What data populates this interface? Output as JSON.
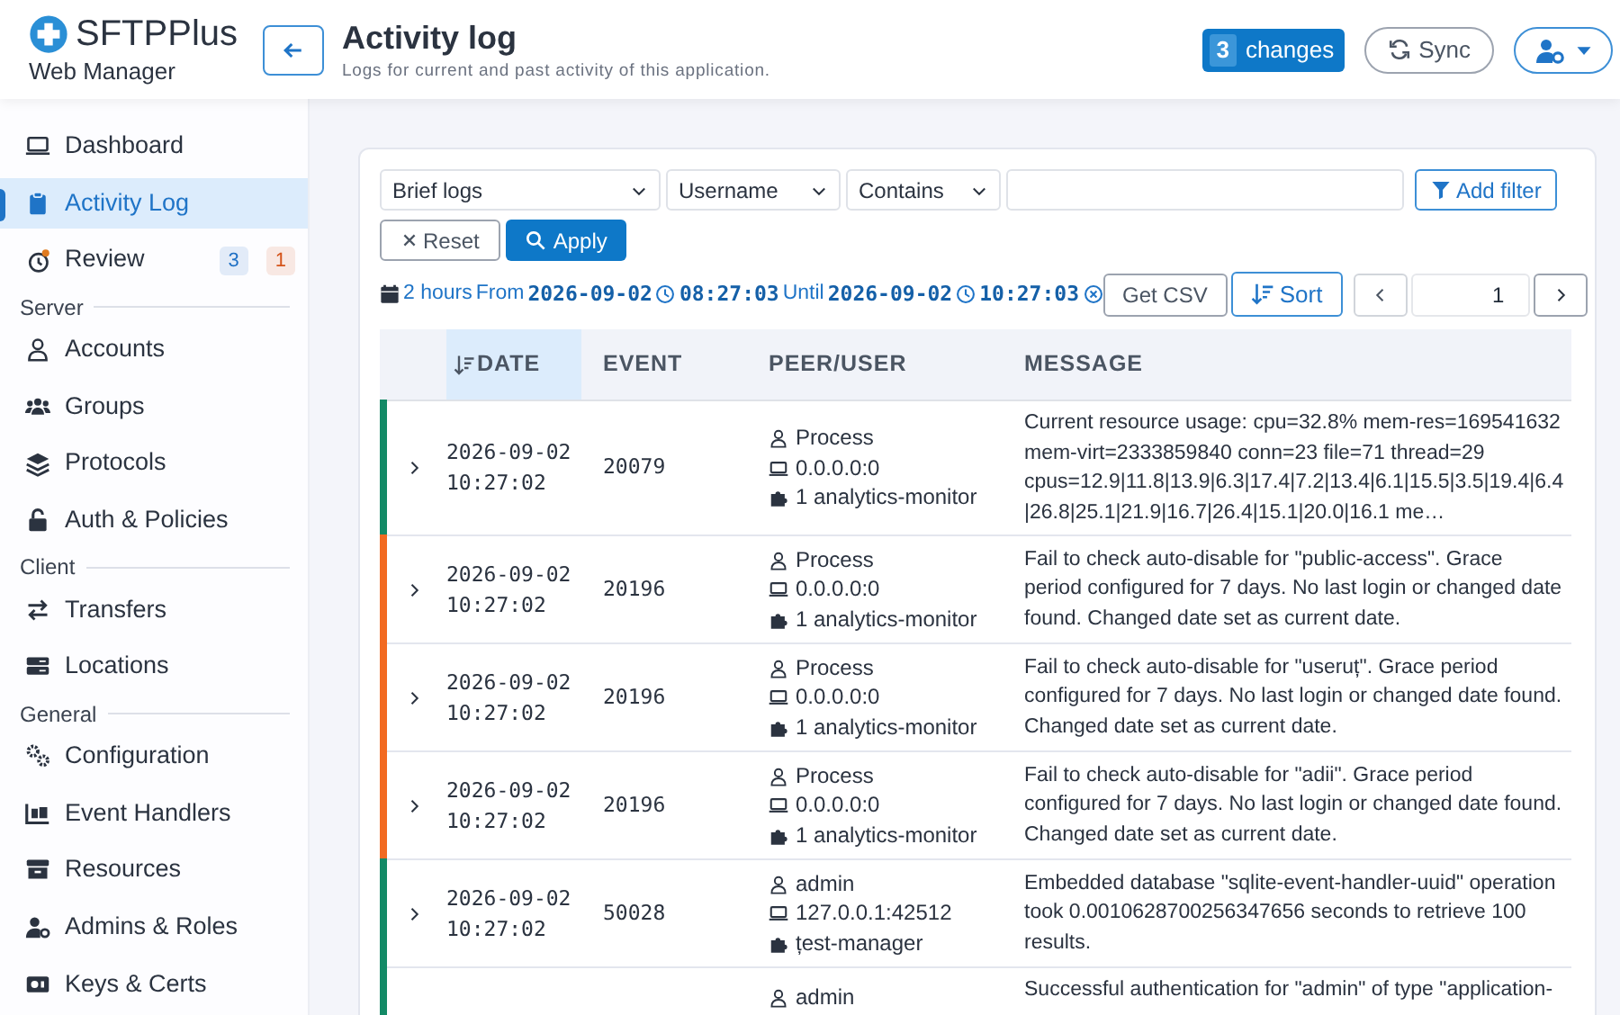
{
  "brand": {
    "name": "SFTPPlus",
    "subtitle": "Web Manager"
  },
  "header": {
    "title": "Activity log",
    "subtitle": "Logs for current and past activity of this application.",
    "changes_count": "3",
    "changes_label": "changes",
    "sync": "Sync"
  },
  "sidebar": [
    {
      "kind": "item",
      "label": "Dashboard",
      "selected": false
    },
    {
      "kind": "item",
      "label": "Activity Log",
      "selected": true
    },
    {
      "kind": "item",
      "label": "Review",
      "selected": false,
      "badges": [
        {
          "text": "3",
          "color": "#1d6fc4"
        },
        {
          "text": "1",
          "color": "#d4541a"
        }
      ]
    },
    {
      "kind": "section",
      "label": "Server"
    },
    {
      "kind": "item",
      "label": "Accounts",
      "selected": false
    },
    {
      "kind": "item",
      "label": "Groups",
      "selected": false
    },
    {
      "kind": "item",
      "label": "Protocols",
      "selected": false
    },
    {
      "kind": "item",
      "label": "Auth & Policies",
      "selected": false
    },
    {
      "kind": "section",
      "label": "Client"
    },
    {
      "kind": "item",
      "label": "Transfers",
      "selected": false
    },
    {
      "kind": "item",
      "label": "Locations",
      "selected": false
    },
    {
      "kind": "section",
      "label": "General"
    },
    {
      "kind": "item",
      "label": "Configuration",
      "selected": false
    },
    {
      "kind": "item",
      "label": "Event Handlers",
      "selected": false
    },
    {
      "kind": "item",
      "label": "Resources",
      "selected": false
    },
    {
      "kind": "item",
      "label": "Admins & Roles",
      "selected": false
    },
    {
      "kind": "item",
      "label": "Keys & Certs",
      "selected": false
    }
  ],
  "filters": {
    "log_type": "Brief logs",
    "field": "Username",
    "operator": "Contains",
    "add_filter": "Add filter",
    "reset": "Reset",
    "apply": "Apply"
  },
  "range": {
    "duration": "2 hours",
    "from_label": "From",
    "from_date": "2026-09-02",
    "from_time": "08:27:03",
    "until_label": "Until",
    "until_date": "2026-09-02",
    "until_time": "10:27:03"
  },
  "toolbar": {
    "csv": "Get CSV",
    "sort": "Sort",
    "page": "1"
  },
  "table": {
    "columns": [
      {
        "label": "DATE",
        "sorted": true
      },
      {
        "label": "EVENT",
        "sorted": false
      },
      {
        "label": "PEER/USER",
        "sorted": false
      },
      {
        "label": "MESSAGE",
        "sorted": false
      }
    ],
    "rows": [
      {
        "color": "#138a66",
        "date": "2026-09-02",
        "time": "10:27:02",
        "event": "20079",
        "user": "Process",
        "address": "0.0.0.0:0",
        "component": "1 analytics-monitor",
        "message": "Current resource usage: cpu=32.8% mem-res=169541632 mem-virt=2333859840 conn=23 file=71 thread=29 cpus=12.9|11.8|13.9|6.3|17.4|7.2|13.4|6.1|15.5|3.5|19.4|6.4|26.8|25.1|21.9|16.7|26.4|15.1|20.0|16.1 me…"
      },
      {
        "color": "#f26a21",
        "date": "2026-09-02",
        "time": "10:27:02",
        "event": "20196",
        "user": "Process",
        "address": "0.0.0.0:0",
        "component": "1 analytics-monitor",
        "message": "Fail to check auto-disable for \"public-access\". Grace period configured for 7 days. No last login or changed date found. Changed date set as current date."
      },
      {
        "color": "#f26a21",
        "date": "2026-09-02",
        "time": "10:27:02",
        "event": "20196",
        "user": "Process",
        "address": "0.0.0.0:0",
        "component": "1 analytics-monitor",
        "message": "Fail to check auto-disable for \"useruț\". Grace period configured for 7 days. No last login or changed date found. Changed date set as current date."
      },
      {
        "color": "#f26a21",
        "date": "2026-09-02",
        "time": "10:27:02",
        "event": "20196",
        "user": "Process",
        "address": "0.0.0.0:0",
        "component": "1 analytics-monitor",
        "message": "Fail to check auto-disable for \"adii\". Grace period configured for 7 days. No last login or changed date found. Changed date set as current date."
      },
      {
        "color": "#138a66",
        "date": "2026-09-02",
        "time": "10:27:02",
        "event": "50028",
        "user": "admin",
        "address": "127.0.0.1:42512",
        "component": "țest-manager",
        "message": "Embedded database \"sqlite-event-handler-uuid\" operation took 0.0010628700256347656 seconds to retrieve 100 results."
      },
      {
        "color": "#138a66",
        "user": "admin",
        "message": "Successful authentication for \"admin\" of type \"application-"
      }
    ]
  }
}
